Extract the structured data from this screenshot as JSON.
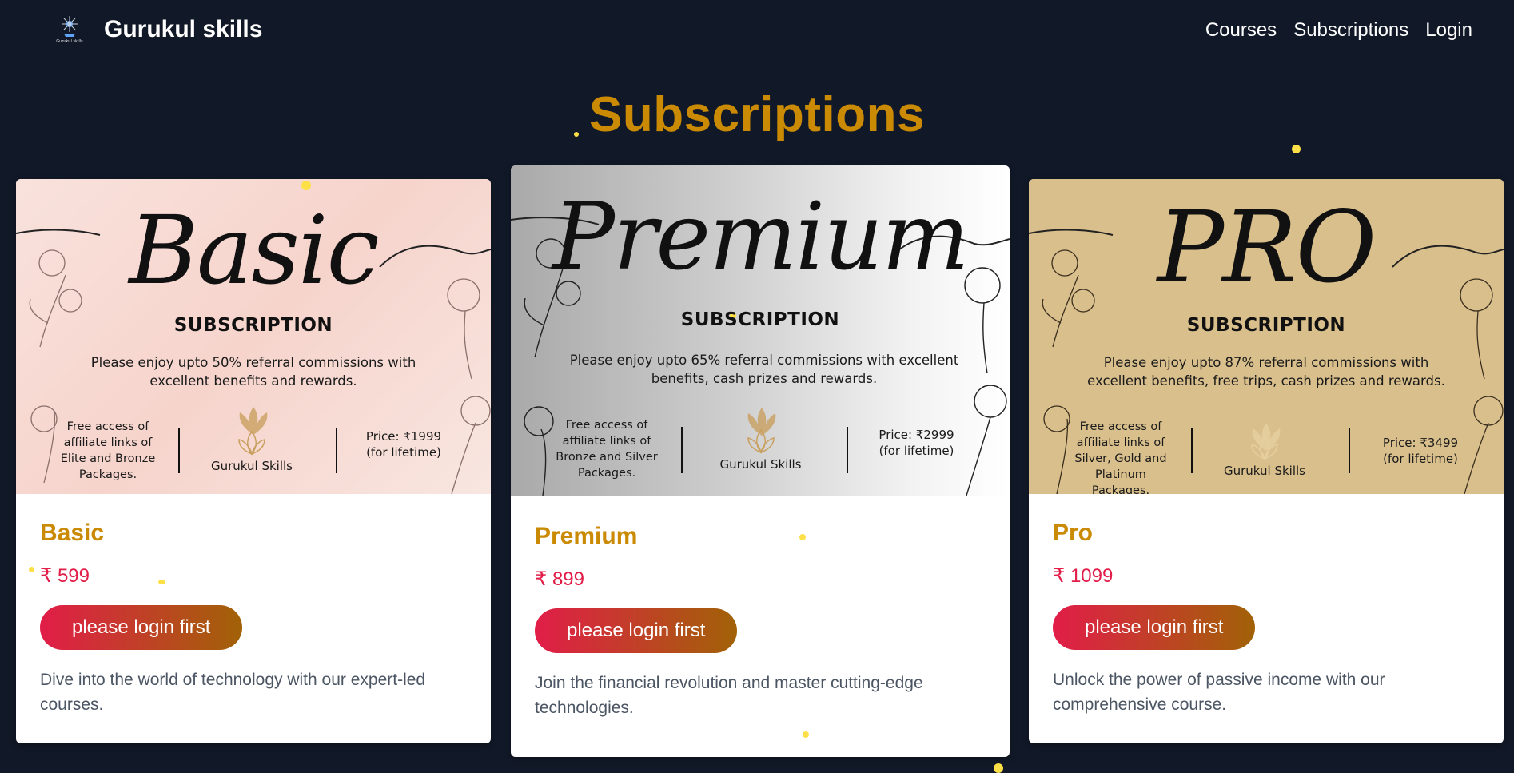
{
  "nav": {
    "brand": "Gurukul skills",
    "logo_text": "Gurukul skills",
    "links": [
      "Courses",
      "Subscriptions",
      "Login"
    ]
  },
  "page": {
    "title": "Subscriptions"
  },
  "colors": {
    "background": "#111827",
    "accent": "#ca8a04",
    "price": "#e11d48"
  },
  "plans": [
    {
      "banner_script": "Basic",
      "banner_label": "SUBSCRIPTION",
      "banner_desc": "Please enjoy upto 50% referral commissions  with excellent benefits and rewards.",
      "banner_access": "Free access of affiliate links of Elite and Bronze Packages.",
      "banner_brand": "Gurukul Skills",
      "banner_price": "Price: ₹1999",
      "banner_price_note": "(for lifetime)",
      "name": "Basic",
      "price": "₹ 599",
      "button": "please login first",
      "description": "Dive into the world of technology with our expert-led courses."
    },
    {
      "banner_script": "Premium",
      "banner_label": "SUBSCRIPTION",
      "banner_desc": "Please enjoy upto 65% referral commissions  with excellent benefits, cash prizes and rewards.",
      "banner_access": "Free access of affiliate links of Bronze and Silver Packages.",
      "banner_brand": "Gurukul Skills",
      "banner_price": "Price: ₹2999",
      "banner_price_note": "(for lifetime)",
      "name": "Premium",
      "price": "₹ 899",
      "button": "please login first",
      "description": "Join the financial revolution and master cutting-edge technologies."
    },
    {
      "banner_script": "PRO",
      "banner_label": "SUBSCRIPTION",
      "banner_desc": "Please enjoy upto 87% referral commissions  with excellent benefits, free trips, cash prizes and rewards.",
      "banner_access": "Free access of affiliate links of Silver, Gold and Platinum Packages.",
      "banner_brand": "Gurukul Skills",
      "banner_price": "Price: ₹3499",
      "banner_price_note": "(for lifetime)",
      "name": "Pro",
      "price": "₹ 1099",
      "button": "please login first",
      "description": "Unlock the power of passive income with our comprehensive course."
    }
  ]
}
